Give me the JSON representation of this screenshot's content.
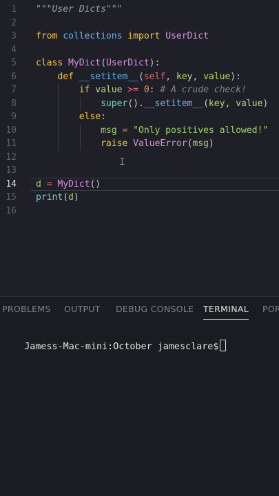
{
  "editor": {
    "current_line": "14",
    "lines": [
      {
        "n": "1",
        "tokens": [
          {
            "c": "doc",
            "t": "\"\"\"User Dicts\"\"\""
          }
        ]
      },
      {
        "n": "2",
        "tokens": []
      },
      {
        "n": "3",
        "tokens": [
          {
            "c": "kw",
            "t": "from"
          },
          {
            "c": "plain",
            "t": " "
          },
          {
            "c": "fn",
            "t": "collections"
          },
          {
            "c": "plain",
            "t": " "
          },
          {
            "c": "kw",
            "t": "import"
          },
          {
            "c": "plain",
            "t": " "
          },
          {
            "c": "cls",
            "t": "UserDict"
          }
        ]
      },
      {
        "n": "4",
        "tokens": []
      },
      {
        "n": "5",
        "tokens": [
          {
            "c": "kw",
            "t": "class"
          },
          {
            "c": "plain",
            "t": " "
          },
          {
            "c": "cls",
            "t": "MyDict"
          },
          {
            "c": "punc",
            "t": "("
          },
          {
            "c": "cls",
            "t": "UserDict"
          },
          {
            "c": "punc",
            "t": "):"
          }
        ]
      },
      {
        "n": "6",
        "tokens": [
          {
            "c": "plain",
            "t": "    "
          },
          {
            "c": "kw",
            "t": "def"
          },
          {
            "c": "plain",
            "t": " "
          },
          {
            "c": "fn",
            "t": "__setitem__"
          },
          {
            "c": "punc",
            "t": "("
          },
          {
            "c": "ptok",
            "t": "self"
          },
          {
            "c": "punc",
            "t": ", "
          },
          {
            "c": "param",
            "t": "key"
          },
          {
            "c": "punc",
            "t": ", "
          },
          {
            "c": "param",
            "t": "value"
          },
          {
            "c": "punc",
            "t": "):"
          }
        ]
      },
      {
        "n": "7",
        "tokens": [
          {
            "c": "plain",
            "t": "        "
          },
          {
            "c": "kw",
            "t": "if"
          },
          {
            "c": "plain",
            "t": " "
          },
          {
            "c": "param",
            "t": "value"
          },
          {
            "c": "plain",
            "t": " "
          },
          {
            "c": "op",
            "t": ">="
          },
          {
            "c": "plain",
            "t": " "
          },
          {
            "c": "num",
            "t": "0"
          },
          {
            "c": "punc",
            "t": ":"
          },
          {
            "c": "plain",
            "t": " "
          },
          {
            "c": "cmt",
            "t": "# A crude check!"
          }
        ]
      },
      {
        "n": "8",
        "tokens": [
          {
            "c": "plain",
            "t": "            "
          },
          {
            "c": "fn2",
            "t": "super"
          },
          {
            "c": "punc",
            "t": "()."
          },
          {
            "c": "fn",
            "t": "__setitem__"
          },
          {
            "c": "punc",
            "t": "("
          },
          {
            "c": "param",
            "t": "key"
          },
          {
            "c": "punc",
            "t": ", "
          },
          {
            "c": "param",
            "t": "value"
          },
          {
            "c": "punc",
            "t": ")"
          }
        ]
      },
      {
        "n": "9",
        "tokens": [
          {
            "c": "plain",
            "t": "        "
          },
          {
            "c": "kw",
            "t": "else"
          },
          {
            "c": "punc",
            "t": ":"
          }
        ]
      },
      {
        "n": "10",
        "tokens": [
          {
            "c": "plain",
            "t": "            "
          },
          {
            "c": "var",
            "t": "msg"
          },
          {
            "c": "plain",
            "t": " "
          },
          {
            "c": "op",
            "t": "="
          },
          {
            "c": "plain",
            "t": " "
          },
          {
            "c": "str",
            "t": "\"Only positives allowed!\""
          }
        ]
      },
      {
        "n": "11",
        "tokens": [
          {
            "c": "plain",
            "t": "            "
          },
          {
            "c": "kw",
            "t": "raise"
          },
          {
            "c": "plain",
            "t": " "
          },
          {
            "c": "cls",
            "t": "ValueError"
          },
          {
            "c": "punc",
            "t": "("
          },
          {
            "c": "var",
            "t": "msg"
          },
          {
            "c": "punc",
            "t": ")"
          }
        ]
      },
      {
        "n": "12",
        "tokens": []
      },
      {
        "n": "13",
        "tokens": []
      },
      {
        "n": "14",
        "tokens": [
          {
            "c": "var",
            "t": "d"
          },
          {
            "c": "plain",
            "t": " "
          },
          {
            "c": "op",
            "t": "="
          },
          {
            "c": "plain",
            "t": " "
          },
          {
            "c": "cls",
            "t": "MyDict"
          },
          {
            "c": "punc",
            "t": "()"
          }
        ]
      },
      {
        "n": "15",
        "tokens": [
          {
            "c": "fn2",
            "t": "print"
          },
          {
            "c": "punc",
            "t": "("
          },
          {
            "c": "var",
            "t": "d"
          },
          {
            "c": "punc",
            "t": ")"
          }
        ]
      },
      {
        "n": "16",
        "tokens": []
      }
    ]
  },
  "panel": {
    "tabs": [
      "PROBLEMS",
      "OUTPUT",
      "DEBUG CONSOLE",
      "TERMINAL",
      "POR"
    ],
    "active_tab": "TERMINAL",
    "terminal_prompt": "Jamess-Mac-mini:October jamesclare$"
  },
  "colors": {
    "editor_bg": "#1f2027",
    "panel_bg": "#1b1c21",
    "keyword": "#f5c542",
    "class": "#d78fe0",
    "function": "#5fb4f0",
    "string": "#9ed06a"
  },
  "icons": {
    "mouse_cursor": "text-ibeam-cursor"
  }
}
